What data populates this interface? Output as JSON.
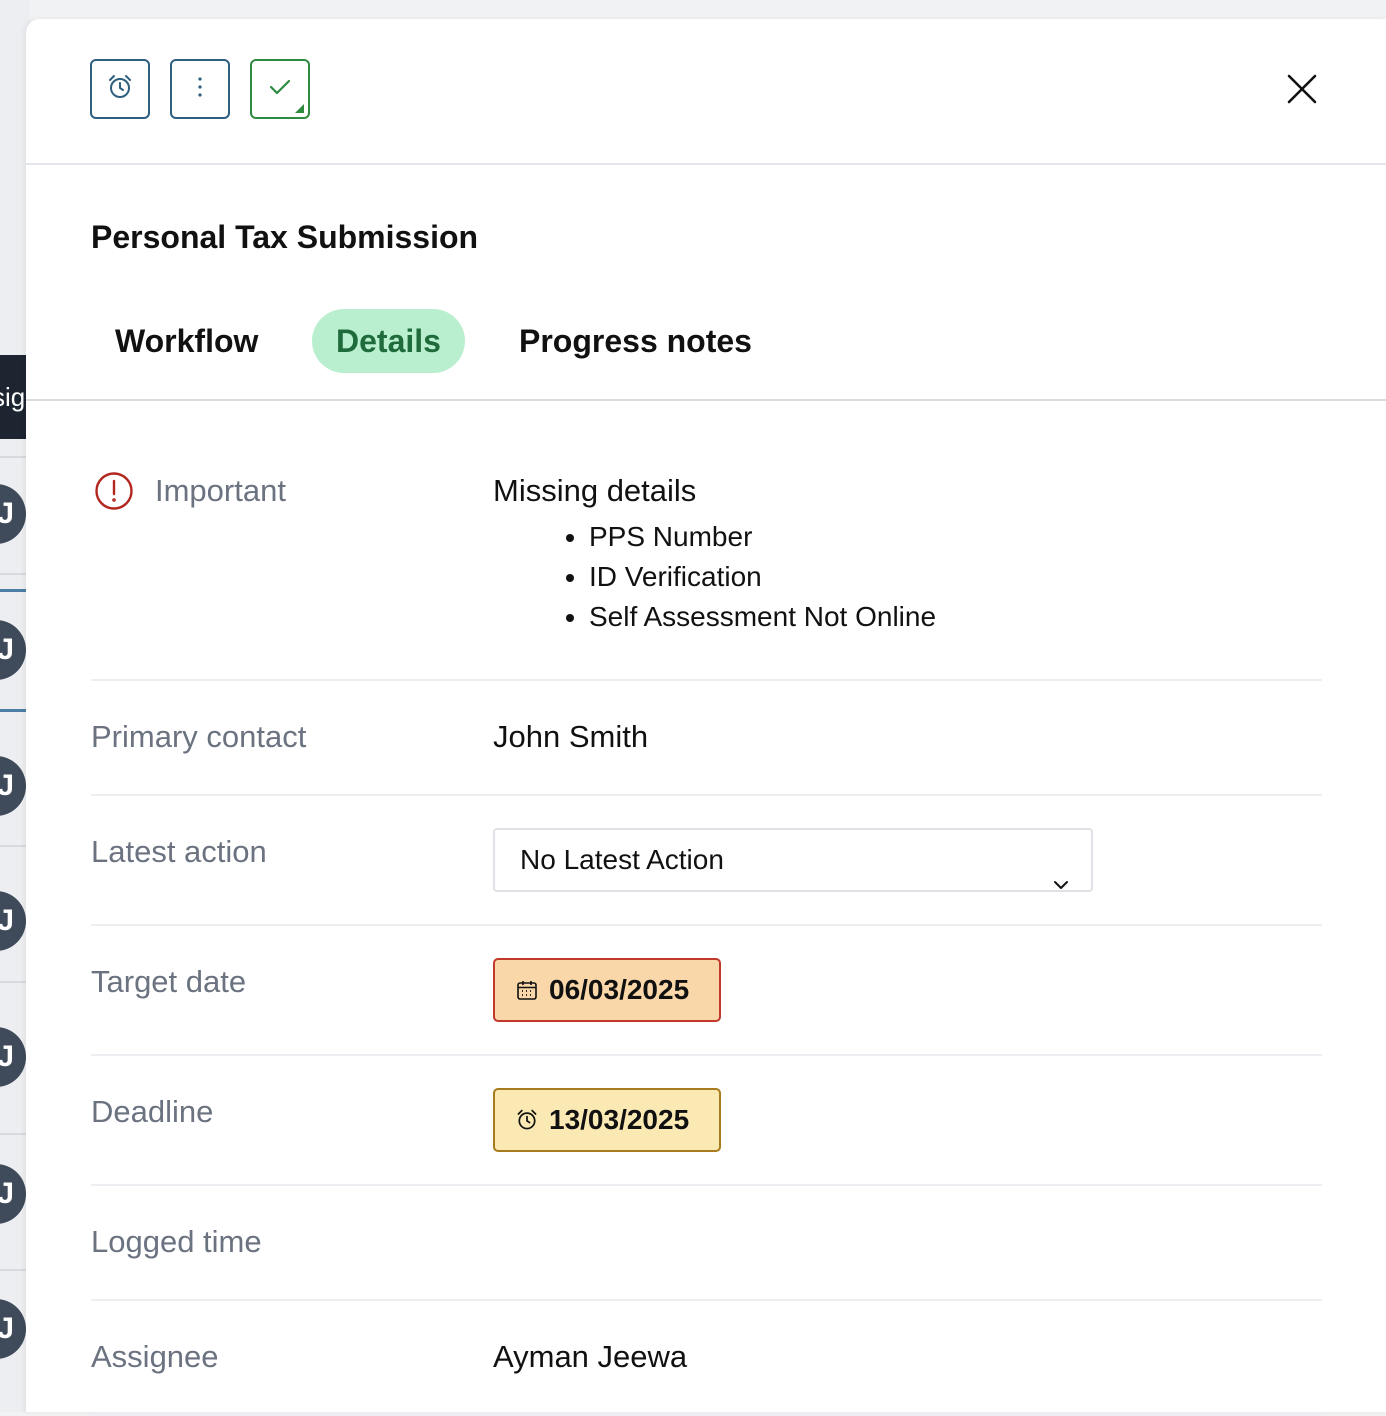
{
  "background": {
    "tab_text": "sign",
    "avatar_initial": "J"
  },
  "toolbar": {
    "reminder_icon": "alarm-clock-icon",
    "more_icon": "vertical-ellipsis-icon",
    "complete_icon": "checkmark-icon",
    "close_icon": "close-x-icon"
  },
  "title": "Personal Tax Submission",
  "tabs": [
    {
      "label": "Workflow",
      "active": false
    },
    {
      "label": "Details",
      "active": true
    },
    {
      "label": "Progress notes",
      "active": false
    }
  ],
  "important": {
    "label": "Important",
    "heading": "Missing details",
    "items": [
      "PPS Number",
      "ID Verification",
      "Self Assessment Not Online"
    ]
  },
  "fields": {
    "primary_contact": {
      "label": "Primary contact",
      "value": "John Smith"
    },
    "latest_action": {
      "label": "Latest action",
      "value": "No Latest Action"
    },
    "target_date": {
      "label": "Target date",
      "value": "06/03/2025"
    },
    "deadline": {
      "label": "Deadline",
      "value": "13/03/2025"
    },
    "logged_time": {
      "label": "Logged time",
      "value": ""
    },
    "assignee": {
      "label": "Assignee",
      "value": "Ayman Jeewa"
    }
  },
  "colors": {
    "accent_blue": "#2d5f7f",
    "success_green": "#2e8a3e",
    "active_tab_bg": "#b9efcf",
    "target_date_bg": "#f9d7a9",
    "deadline_bg": "#fbe9b4",
    "important_red": "#c0392b"
  }
}
